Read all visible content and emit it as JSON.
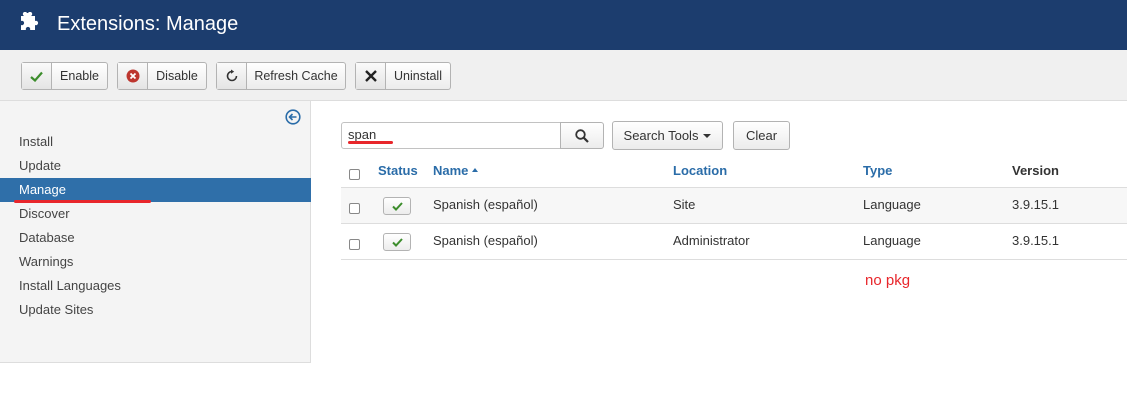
{
  "header": {
    "title": "Extensions: Manage",
    "icon": "puzzle-icon",
    "background": "#1c3d6e"
  },
  "toolbar": {
    "buttons": [
      {
        "label": "Enable",
        "icon": "check-icon"
      },
      {
        "label": "Disable",
        "icon": "disable-icon"
      },
      {
        "label": "Refresh Cache",
        "icon": "refresh-icon"
      },
      {
        "label": "Uninstall",
        "icon": "close-icon"
      }
    ]
  },
  "sidebar": {
    "items": [
      {
        "label": "Install"
      },
      {
        "label": "Update"
      },
      {
        "label": "Manage",
        "active": true
      },
      {
        "label": "Discover"
      },
      {
        "label": "Database"
      },
      {
        "label": "Warnings"
      },
      {
        "label": "Install Languages"
      },
      {
        "label": "Update Sites"
      }
    ],
    "active_color": "#2f6fa9"
  },
  "search": {
    "value": "span",
    "search_tools_label": "Search Tools",
    "clear_label": "Clear"
  },
  "table": {
    "columns": [
      "Status",
      "Name",
      "Location",
      "Type",
      "Version"
    ],
    "rows": [
      {
        "name": "Spanish (español)",
        "location": "Site",
        "type": "Language",
        "version": "3.9.15.1"
      },
      {
        "name": "Spanish (español)",
        "location": "Administrator",
        "type": "Language",
        "version": "3.9.15.1"
      }
    ]
  },
  "annotation": {
    "note": "no pkg",
    "color": "#e8262b"
  }
}
